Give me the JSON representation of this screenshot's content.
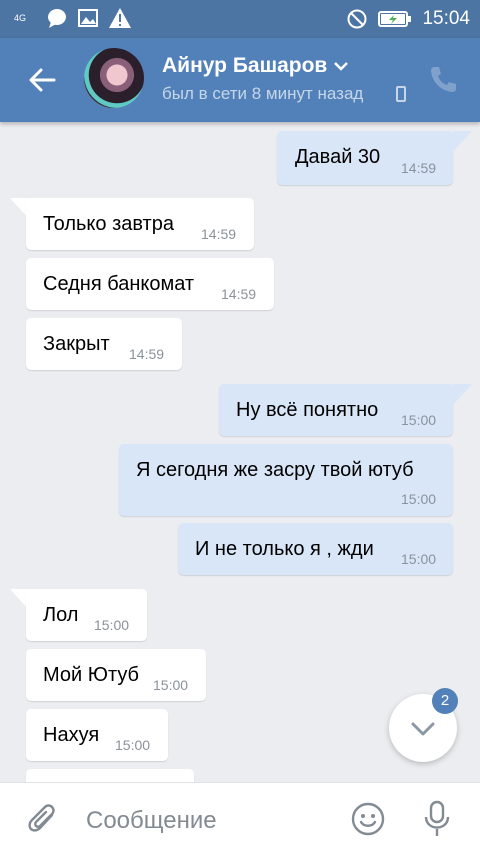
{
  "status_bar": {
    "network": "4G",
    "time": "15:04"
  },
  "header": {
    "name": "Айнур Башаров",
    "status": "был в сети 8 минут назад"
  },
  "messages": [
    {
      "dir": "out",
      "text": "Давай 30",
      "time": "14:59"
    },
    {
      "dir": "in",
      "text": "Только завтра",
      "time": "14:59"
    },
    {
      "dir": "in",
      "text": "Седня банкомат",
      "time": "14:59"
    },
    {
      "dir": "in",
      "text": "Закрыт",
      "time": "14:59"
    },
    {
      "dir": "out",
      "text": "Ну всё понятно",
      "time": "15:00"
    },
    {
      "dir": "out",
      "text": "Я сегодня же засру твой ютуб",
      "time": "15:00"
    },
    {
      "dir": "out",
      "text": "И не только я , жди",
      "time": "15:00"
    },
    {
      "dir": "in",
      "text": "Лол",
      "time": "15:00"
    },
    {
      "dir": "in",
      "text": "Мой Ютуб",
      "time": "15:00"
    },
    {
      "dir": "in",
      "text": "Нахуя",
      "time": "15:00"
    }
  ],
  "scroll_badge": "2",
  "composer": {
    "placeholder": "Сообщение"
  },
  "colors": {
    "header": "#5181b8",
    "outgoing_bubble": "#d9e6f7",
    "background": "#ebedf0"
  }
}
